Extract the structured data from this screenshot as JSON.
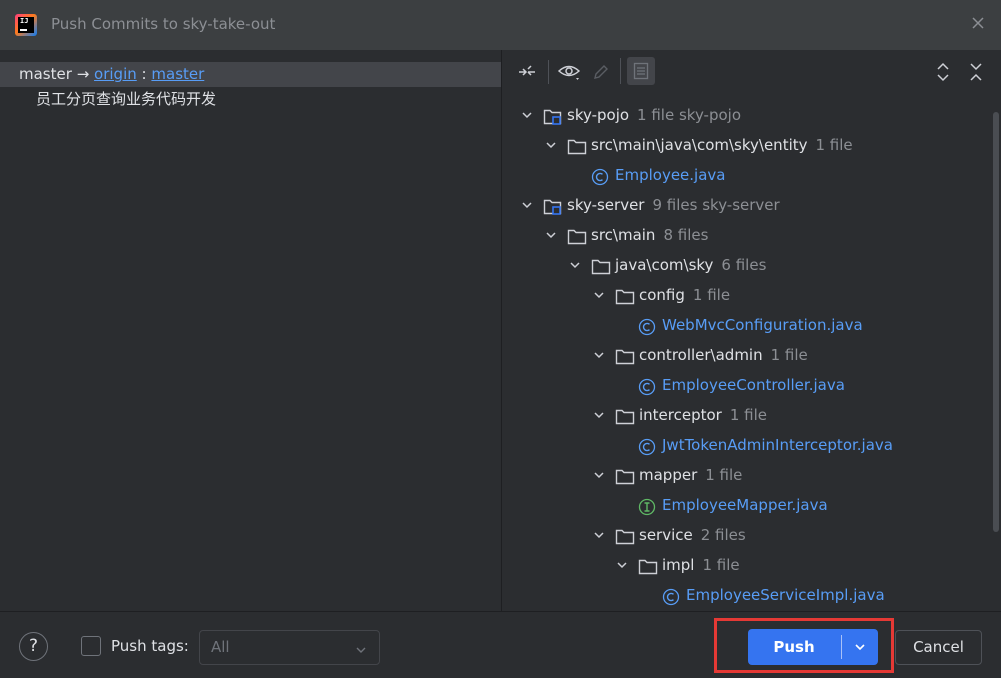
{
  "window": {
    "title": "Push Commits to sky-take-out",
    "logo_text": "IJ",
    "close_icon": "close-icon"
  },
  "left": {
    "branch": {
      "local": "master",
      "arrow": "→",
      "remote": "origin",
      "sep": ":",
      "target": "master"
    },
    "commit_message": "员工分页查询业务代码开发"
  },
  "toolbar": {
    "icons": [
      "collapse-arrows-icon",
      "eye-icon",
      "pencil-icon",
      "details-panel-icon",
      "expand-all-icon",
      "collapse-all-icon"
    ]
  },
  "tree": [
    {
      "label": "sky-pojo",
      "meta": "1 file  sky-pojo",
      "kind": "module"
    },
    {
      "label": "src\\main\\java\\com\\sky\\entity",
      "meta": "1 file",
      "kind": "folder"
    },
    {
      "label": "Employee.java",
      "meta": "",
      "kind": "class"
    },
    {
      "label": "sky-server",
      "meta": "9 files  sky-server",
      "kind": "module"
    },
    {
      "label": "src\\main",
      "meta": "8 files",
      "kind": "folder"
    },
    {
      "label": "java\\com\\sky",
      "meta": "6 files",
      "kind": "folder"
    },
    {
      "label": "config",
      "meta": "1 file",
      "kind": "folder"
    },
    {
      "label": "WebMvcConfiguration.java",
      "meta": "",
      "kind": "class"
    },
    {
      "label": "controller\\admin",
      "meta": "1 file",
      "kind": "folder"
    },
    {
      "label": "EmployeeController.java",
      "meta": "",
      "kind": "class"
    },
    {
      "label": "interceptor",
      "meta": "1 file",
      "kind": "folder"
    },
    {
      "label": "JwtTokenAdminInterceptor.java",
      "meta": "",
      "kind": "class"
    },
    {
      "label": "mapper",
      "meta": "1 file",
      "kind": "folder"
    },
    {
      "label": "EmployeeMapper.java",
      "meta": "",
      "kind": "interface"
    },
    {
      "label": "service",
      "meta": "2 files",
      "kind": "folder"
    },
    {
      "label": "impl",
      "meta": "1 file",
      "kind": "folder"
    },
    {
      "label": "EmployeeServiceImpl.java",
      "meta": "",
      "kind": "class"
    }
  ],
  "bottom": {
    "help_label": "?",
    "push_tags_label": "Push tags:",
    "tags_value": "All",
    "push_label": "Push",
    "cancel_label": "Cancel"
  },
  "colors": {
    "accent": "#3574f0",
    "link": "#589df6",
    "highlight": "#e53935",
    "interface": "#5fb865"
  }
}
